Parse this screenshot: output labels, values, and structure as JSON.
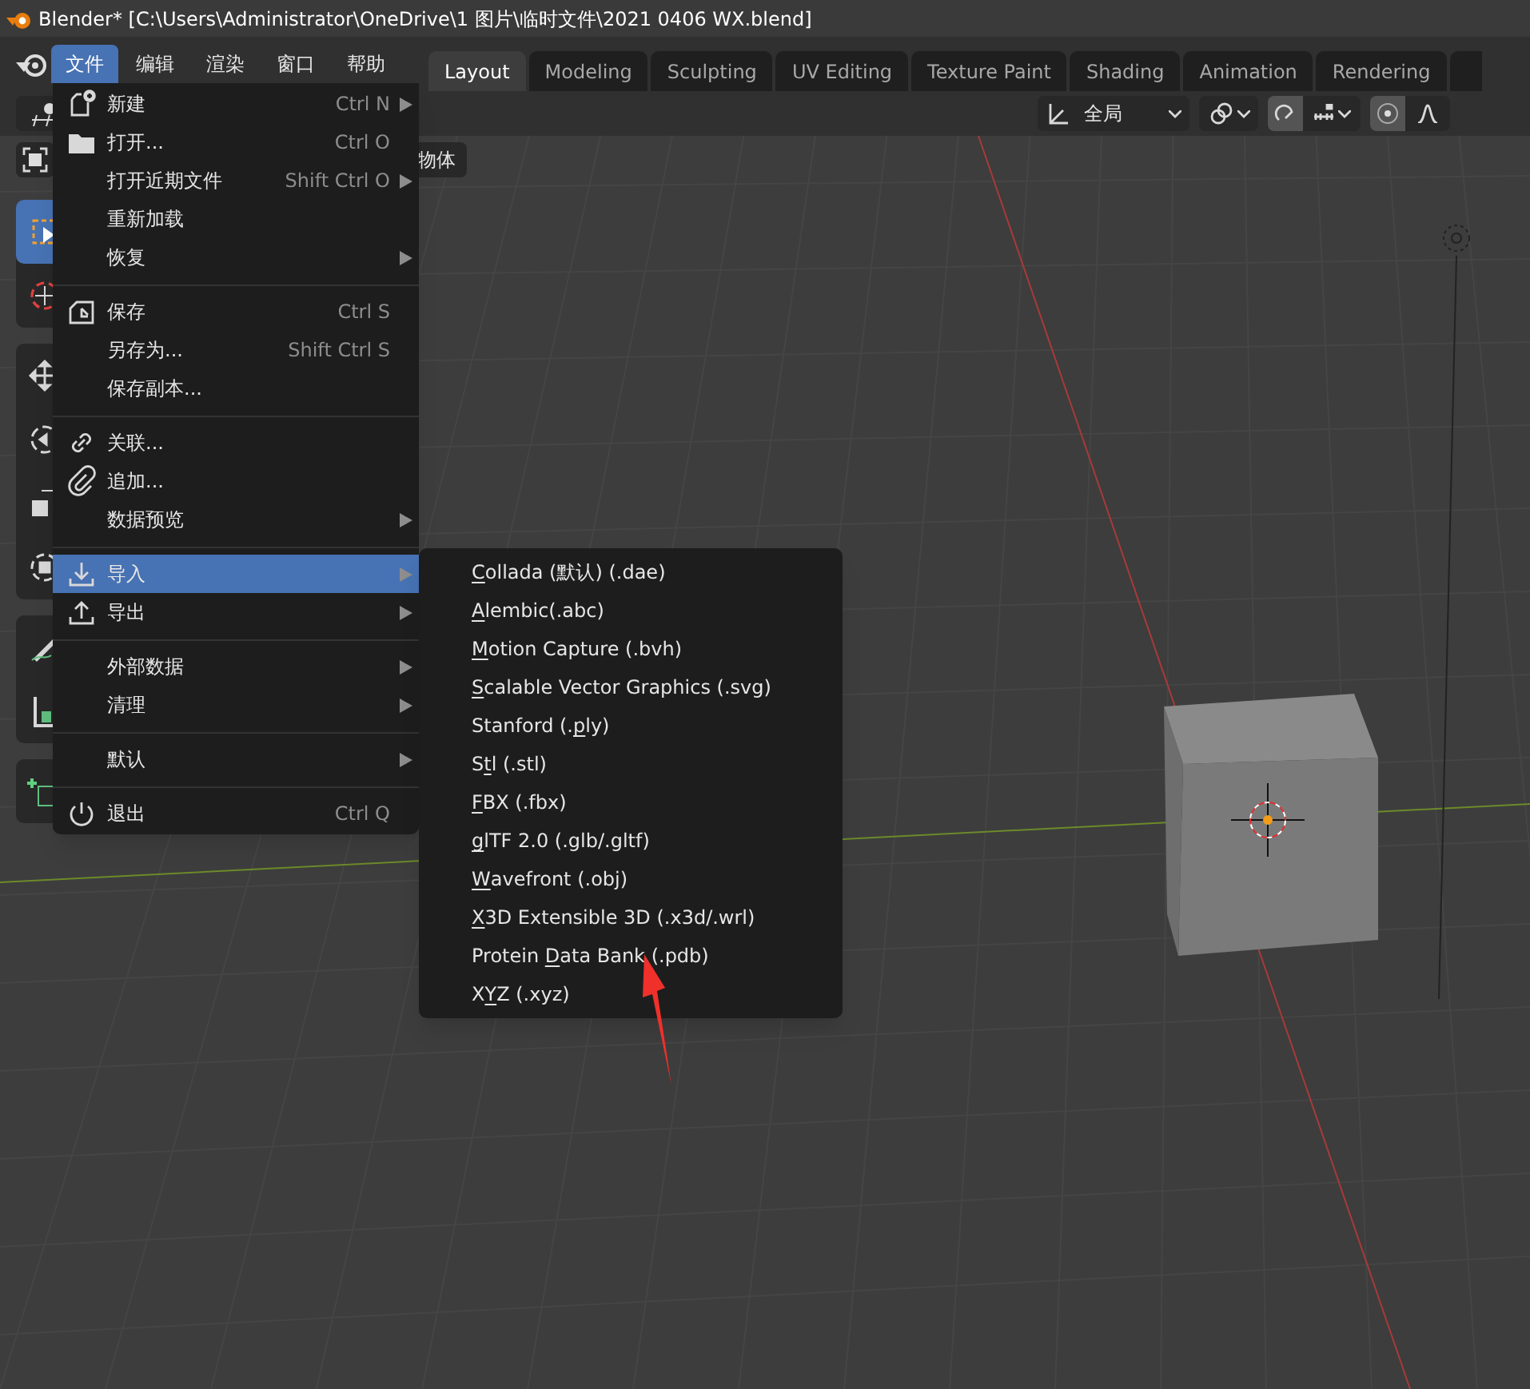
{
  "window": {
    "title": "Blender* [C:\\Users\\Administrator\\OneDrive\\1 图片\\临时文件\\2021 0406 WX.blend]"
  },
  "menubar": [
    {
      "label": "文件",
      "selected": true
    },
    {
      "label": "编辑",
      "selected": false
    },
    {
      "label": "渲染",
      "selected": false
    },
    {
      "label": "窗口",
      "selected": false
    },
    {
      "label": "帮助",
      "selected": false
    }
  ],
  "workspace_tabs": [
    {
      "label": "Layout",
      "selected": true
    },
    {
      "label": "Modeling",
      "selected": false
    },
    {
      "label": "Sculpting",
      "selected": false
    },
    {
      "label": "UV Editing",
      "selected": false
    },
    {
      "label": "Texture Paint",
      "selected": false
    },
    {
      "label": "Shading",
      "selected": false
    },
    {
      "label": "Animation",
      "selected": false
    },
    {
      "label": "Rendering",
      "selected": false
    }
  ],
  "header": {
    "orientation": "全局",
    "object_menu": "物体"
  },
  "tools": [
    {
      "selected": true
    },
    {
      "selected": false
    },
    {
      "selected": false
    },
    {
      "selected": false
    },
    {
      "selected": false
    },
    {
      "selected": false
    },
    {
      "selected": false
    },
    {
      "selected": false
    },
    {
      "selected": false
    }
  ],
  "file_menu": [
    {
      "kind": "item",
      "label": "新建",
      "shortcut": "Ctrl N",
      "submenu": true,
      "selected": false
    },
    {
      "kind": "item",
      "label": "打开...",
      "shortcut": "Ctrl O",
      "submenu": false,
      "selected": false
    },
    {
      "kind": "item",
      "label": "打开近期文件",
      "shortcut": "Shift Ctrl O",
      "submenu": true,
      "selected": false
    },
    {
      "kind": "item",
      "label": "重新加载",
      "submenu": false,
      "selected": false
    },
    {
      "kind": "item",
      "label": "恢复",
      "submenu": true,
      "selected": false
    },
    {
      "kind": "separator"
    },
    {
      "kind": "item",
      "label": "保存",
      "shortcut": "Ctrl S",
      "submenu": false,
      "selected": false
    },
    {
      "kind": "item",
      "label": "另存为...",
      "shortcut": "Shift Ctrl S",
      "submenu": false,
      "selected": false
    },
    {
      "kind": "item",
      "label": "保存副本...",
      "submenu": false,
      "selected": false
    },
    {
      "kind": "separator"
    },
    {
      "kind": "item",
      "label": "关联...",
      "submenu": false,
      "selected": false
    },
    {
      "kind": "item",
      "label": "追加...",
      "submenu": false,
      "selected": false
    },
    {
      "kind": "item",
      "label": "数据预览",
      "submenu": true,
      "selected": false
    },
    {
      "kind": "separator"
    },
    {
      "kind": "item",
      "label": "导入",
      "submenu": true,
      "selected": true
    },
    {
      "kind": "item",
      "label": "导出",
      "submenu": true,
      "selected": false
    },
    {
      "kind": "separator"
    },
    {
      "kind": "item",
      "label": "外部数据",
      "submenu": true,
      "selected": false
    },
    {
      "kind": "item",
      "label": "清理",
      "submenu": true,
      "selected": false
    },
    {
      "kind": "separator"
    },
    {
      "kind": "item",
      "label": "默认",
      "submenu": true,
      "selected": false
    },
    {
      "kind": "separator"
    },
    {
      "kind": "item",
      "label": "退出",
      "shortcut": "Ctrl Q",
      "submenu": false,
      "selected": false
    }
  ],
  "import_menu": [
    {
      "parts": [
        {
          "text": "C",
          "underlined": true
        },
        {
          "text": "ollada (默认) (.dae)",
          "underlined": false
        }
      ]
    },
    {
      "parts": [
        {
          "text": "A",
          "underlined": true
        },
        {
          "text": "lembic(.abc)",
          "underlined": false
        }
      ]
    },
    {
      "parts": [
        {
          "text": "M",
          "underlined": true
        },
        {
          "text": "otion Capture (.bvh)",
          "underlined": false
        }
      ]
    },
    {
      "parts": [
        {
          "text": "S",
          "underlined": true
        },
        {
          "text": "calable Vector Graphics (.svg)",
          "underlined": false
        }
      ]
    },
    {
      "parts": [
        {
          "text": "Stanford (.",
          "underlined": false
        },
        {
          "text": "p",
          "underlined": true
        },
        {
          "text": "ly)",
          "underlined": false
        }
      ]
    },
    {
      "parts": [
        {
          "text": "S",
          "underlined": false
        },
        {
          "text": "t",
          "underlined": true
        },
        {
          "text": "l (.stl)",
          "underlined": false
        }
      ]
    },
    {
      "parts": [
        {
          "text": "F",
          "underlined": true
        },
        {
          "text": "BX (.fbx)",
          "underlined": false
        }
      ]
    },
    {
      "parts": [
        {
          "text": "g",
          "underlined": true
        },
        {
          "text": "lTF 2.0 (.glb/.gltf)",
          "underlined": false
        }
      ]
    },
    {
      "parts": [
        {
          "text": "W",
          "underlined": true
        },
        {
          "text": "avefront (.obj)",
          "underlined": false
        }
      ]
    },
    {
      "parts": [
        {
          "text": "X",
          "underlined": true
        },
        {
          "text": "3D Extensible 3D (.x3d/.wrl)",
          "underlined": false
        }
      ]
    },
    {
      "parts": [
        {
          "text": "Protein ",
          "underlined": false
        },
        {
          "text": "D",
          "underlined": true
        },
        {
          "text": "ata Bank (.pdb)",
          "underlined": false
        }
      ]
    },
    {
      "parts": [
        {
          "text": "X",
          "underlined": false
        },
        {
          "text": "Y",
          "underlined": true
        },
        {
          "text": "Z (.xyz)",
          "underlined": false
        }
      ]
    }
  ]
}
